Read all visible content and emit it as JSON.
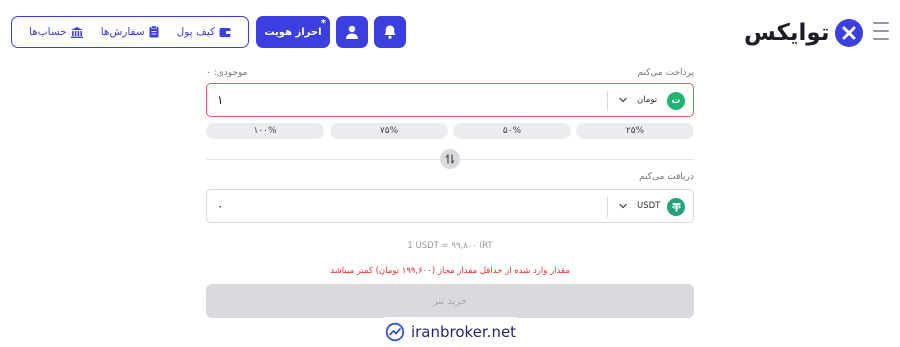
{
  "header": {
    "logo_text": "توایکس",
    "kyc_label": "احراز هویت",
    "kyc_dot": "*",
    "nav": [
      {
        "label": "کیف پول",
        "icon": "wallet-icon"
      },
      {
        "label": "سفارش‌ها",
        "icon": "orders-icon"
      },
      {
        "label": "حساب‌ها",
        "icon": "bank-icon"
      }
    ],
    "icons": {
      "bell": "bell-icon",
      "user": "user-icon",
      "menu": "menu-icon"
    }
  },
  "pay": {
    "label": "پرداخت می‌کنم",
    "balance_label": "موجودی: ۰",
    "amount": "۱",
    "currency": "تومان",
    "currency_icon_text": "ت",
    "currency_color": "#22b573"
  },
  "percent_buttons": [
    "۲۵%",
    "۵۰%",
    "۷۵%",
    "۱۰۰%"
  ],
  "receive": {
    "label": "دریافت می‌کنم",
    "amount": "۰",
    "currency": "USDT",
    "currency_color": "#26a17b"
  },
  "rate_text": "1 USDT = ۹۹,۸۰۰ IRT",
  "error_text": "مقدار وارد شده از حداقل مقدار مجاز (۱۹۹,۶۰۰ تومان) کمتر میباشد",
  "buy_button": "خرید تتر",
  "watermark": "iranbroker.net",
  "colors": {
    "accent": "#3b3fe0",
    "error": "#e03030"
  }
}
